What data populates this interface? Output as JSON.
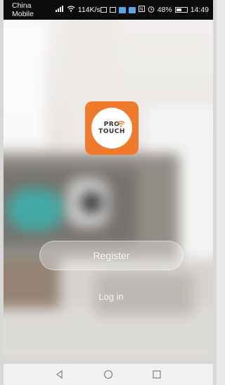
{
  "status_bar": {
    "carrier": "China Mobile",
    "speed": "114K/s",
    "battery": "48%",
    "time": "14:49"
  },
  "logo": {
    "line1": "PRO",
    "line2": "TOUCH"
  },
  "actions": {
    "register_label": "Register",
    "login_label": "Log in"
  },
  "colors": {
    "brand_orange": "#ef7a2c"
  },
  "icons": [
    "signal-icon",
    "wifi-icon",
    "mail-icon",
    "image-icon",
    "app-icon",
    "nfc-icon",
    "alarm-icon",
    "battery-icon",
    "back-icon",
    "home-icon",
    "recents-icon"
  ]
}
